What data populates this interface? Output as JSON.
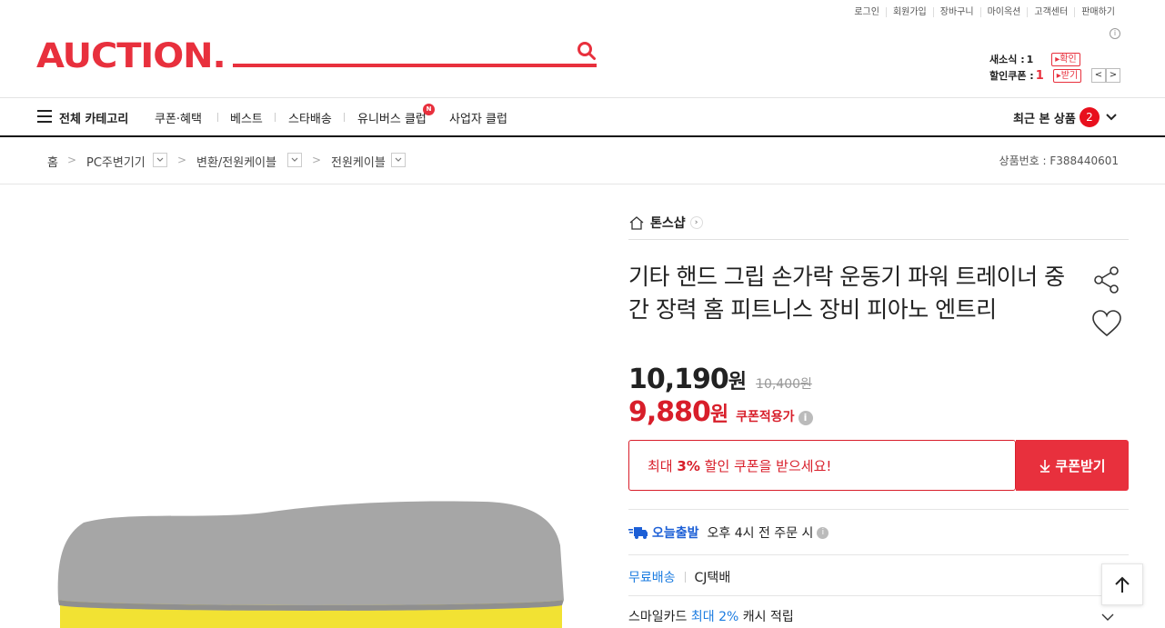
{
  "util_links": [
    "로그인",
    "회원가입",
    "장바구니",
    "마이옥션",
    "고객센터",
    "판매하기"
  ],
  "util_info": "i",
  "logo": "AUCTION.",
  "search": {
    "placeholder": ""
  },
  "coupon_box": {
    "news_label": "새소식 :",
    "news_count": "1",
    "news_btn": "확인",
    "coupon_label": "할인쿠폰 :",
    "coupon_count": "1",
    "coupon_btn": "받기",
    "prev": "<",
    "next": ">"
  },
  "nav": {
    "all_category": "전체 카테고리",
    "items": [
      "쿠폰·혜택",
      "베스트",
      "스타배송",
      "유니버스 클럽",
      "사업자 클럽"
    ],
    "new_badge": "N",
    "recent_label": "최근 본 상품",
    "recent_count": "2"
  },
  "breadcrumb": {
    "home": "홈",
    "levels": [
      "PC주변기기",
      "변환/전원케이블",
      "전원케이블"
    ],
    "product_no": "상품번호 : F388440601"
  },
  "product": {
    "shop_name": "톤스샵",
    "title": "기타 핸드 그립 손가락 운동기 파워 트레이너 중간 장력 홈 피트니스 장비 피아노 엔트리",
    "price": "10,190",
    "won": "원",
    "original_price": "10,400원",
    "coupon_price": "9,880",
    "coupon_price_label": "쿠폰적용가",
    "coupon_msg_prefix": "최대",
    "coupon_msg_pct": "3%",
    "coupon_msg_suffix": "할인 쿠폰을 받으세요!",
    "coupon_btn": "쿠폰받기",
    "today_brand": "오늘출발",
    "today_text": "오후 4시 전 주문 시",
    "free_ship": "무료배송",
    "carrier": "CJ택배",
    "smile_prefix": "스마일카드",
    "smile_hl": "최대 2%",
    "smile_suffix": "캐시 적립"
  },
  "colors": {
    "brand_red": "#e8303d",
    "price_red": "#d81e2a",
    "blue": "#1c7ce0",
    "product_cap": "#a6a6a6",
    "product_body": "#f2e233"
  }
}
